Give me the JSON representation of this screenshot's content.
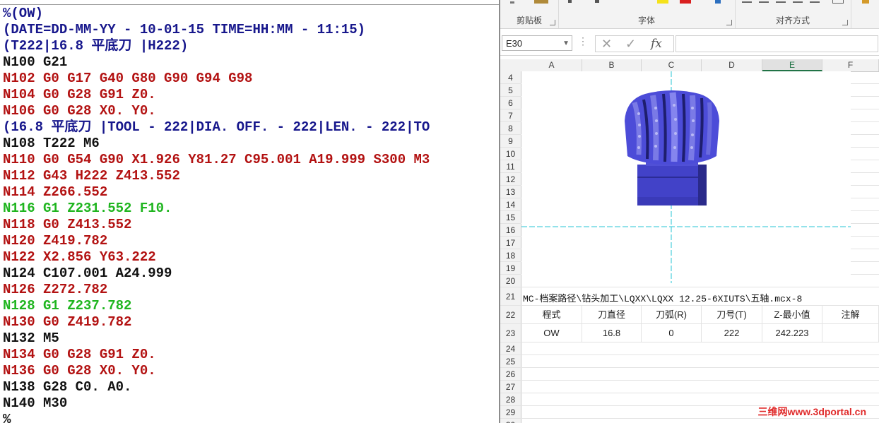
{
  "editor": {
    "lines": [
      {
        "text": "%(OW)",
        "color": "blue"
      },
      {
        "text": "(DATE=DD-MM-YY - 10-01-15 TIME=HH:MM - 11:15)",
        "color": "blue"
      },
      {
        "text": "(T222|16.8 平底刀 |H222)",
        "color": "blue"
      },
      {
        "text": "N100 G21",
        "color": "black"
      },
      {
        "text": "N102 G0 G17 G40 G80 G90 G94 G98",
        "color": "red"
      },
      {
        "text": "N104 G0 G28 G91 Z0.",
        "color": "red"
      },
      {
        "text": "N106 G0 G28 X0. Y0.",
        "color": "red"
      },
      {
        "text": "(16.8 平底刀 |TOOL - 222|DIA. OFF. - 222|LEN. - 222|TO",
        "color": "blue"
      },
      {
        "text": "N108 T222 M6",
        "color": "black"
      },
      {
        "text": "N110 G0 G54 G90 X1.926 Y81.27 C95.001 A19.999 S300 M3",
        "color": "red"
      },
      {
        "text": "N112 G43 H222 Z413.552",
        "color": "red"
      },
      {
        "text": "N114 Z266.552",
        "color": "red"
      },
      {
        "text": "N116 G1 Z231.552 F10.",
        "color": "green"
      },
      {
        "text": "N118 G0 Z413.552",
        "color": "red"
      },
      {
        "text": "N120 Z419.782",
        "color": "red"
      },
      {
        "text": "N122 X2.856 Y63.222",
        "color": "red"
      },
      {
        "text": "N124 C107.001 A24.999",
        "color": "black"
      },
      {
        "text": "N126 Z272.782",
        "color": "red"
      },
      {
        "text": "N128 G1 Z237.782",
        "color": "green"
      },
      {
        "text": "N130 G0 Z419.782",
        "color": "red"
      },
      {
        "text": "N132 M5",
        "color": "black"
      },
      {
        "text": "N134 G0 G28 G91 Z0.",
        "color": "red"
      },
      {
        "text": "N136 G0 G28 X0. Y0.",
        "color": "red"
      },
      {
        "text": "N138 G28 C0. A0.",
        "color": "black"
      },
      {
        "text": "N140 M30",
        "color": "black"
      },
      {
        "text": "%",
        "color": "black"
      }
    ]
  },
  "excel": {
    "ribbon": {
      "clipboard_label": "剪贴板",
      "font_label": "字体",
      "align_label": "对齐方式"
    },
    "namebox": "E30",
    "formula_icons": {
      "cancel": "✕",
      "enter": "✓",
      "fx": "fx"
    },
    "columns": [
      "A",
      "B",
      "C",
      "D",
      "E",
      "F"
    ],
    "selected_column": "E",
    "row_numbers_top": [
      "4",
      "5",
      "6",
      "7",
      "8",
      "9",
      "10",
      "11",
      "12",
      "13",
      "14",
      "15",
      "16",
      "17",
      "18",
      "19",
      "20"
    ],
    "row21_text": "MC-档案路径\\钻头加工\\LQXX\\LQXX  12.25-6XIUTS\\五轴.mcx-8",
    "row21": "21",
    "header_row": {
      "num": "22",
      "cells": [
        "程式",
        "刀直径",
        "刀弧(R)",
        "刀号(T)",
        "Z-最小值",
        "注解"
      ]
    },
    "data_row": {
      "num": "23",
      "cells": [
        "OW",
        "16.8",
        "0",
        "222",
        "242.223",
        ""
      ]
    },
    "row_numbers_bottom": [
      "24",
      "25",
      "26",
      "27",
      "28",
      "29",
      "30"
    ],
    "watermark": "三维网www.3dportal.cn",
    "colors": {
      "tool_body": "#4a4ad6",
      "crosshair": "#27c6d6",
      "selected": "#217346"
    }
  }
}
